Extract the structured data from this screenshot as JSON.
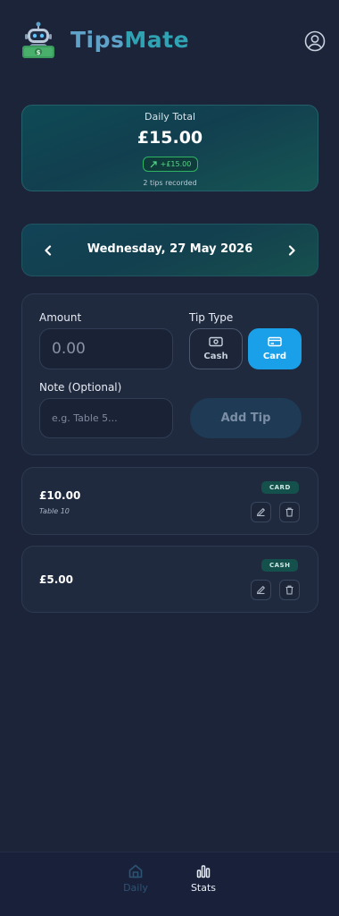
{
  "app": {
    "title_part1": "Tips",
    "title_part2": "Mate"
  },
  "summary": {
    "label": "Daily Total",
    "value": "£15.00",
    "change_badge": "+£15.00",
    "subtitle": "2 tips recorded"
  },
  "date_nav": {
    "date_text": "Wednesday, 27 May 2026"
  },
  "form": {
    "amount_label": "Amount",
    "amount_placeholder": "0.00",
    "tip_type_label": "Tip Type",
    "cash_label": "Cash",
    "card_label": "Card",
    "selected_type": "Card",
    "note_label": "Note (Optional)",
    "note_placeholder": "e.g. Table 5...",
    "add_button_label": "Add Tip"
  },
  "tips": [
    {
      "amount": "£10.00",
      "note": "Table 10",
      "type": "CARD"
    },
    {
      "amount": "£5.00",
      "note": "",
      "type": "CASH"
    }
  ],
  "bottom_nav": {
    "items": [
      {
        "label": "Daily",
        "icon": "home-icon",
        "active": true
      },
      {
        "label": "Stats",
        "icon": "bar-chart-icon",
        "active": false
      }
    ]
  },
  "colors": {
    "background": "#1b2438",
    "accent": "#1aa0e8",
    "positive": "#55d88a",
    "badge_bg": "#14514c"
  }
}
